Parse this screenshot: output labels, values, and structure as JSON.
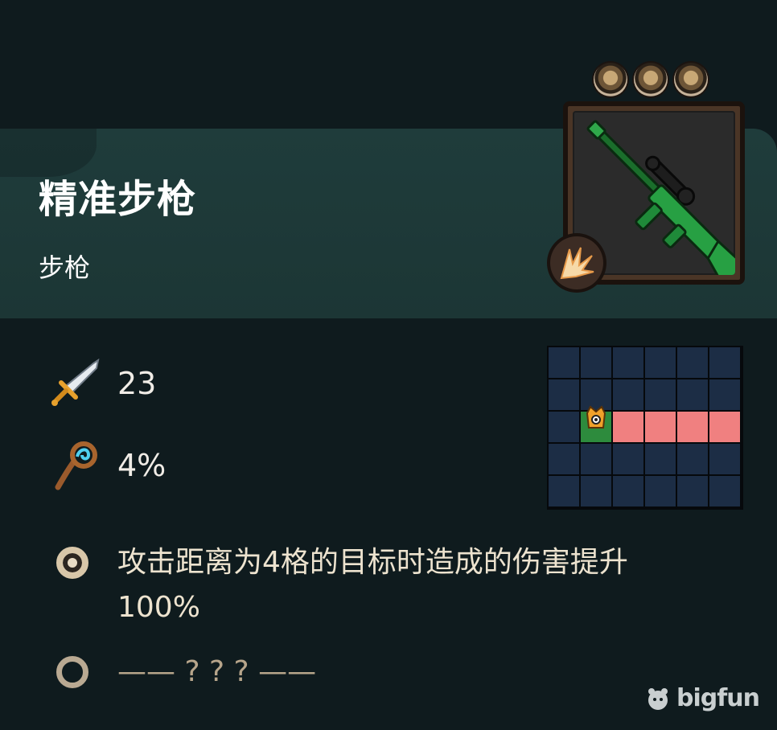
{
  "item": {
    "name": "精准步枪",
    "type": "步枪",
    "level_orbs": 3
  },
  "stats": {
    "attack": "23",
    "crit": "4%"
  },
  "range_grid": {
    "rows": 5,
    "cols": 6,
    "origin": [
      2,
      1
    ],
    "hits": [
      [
        2,
        2
      ],
      [
        2,
        3
      ],
      [
        2,
        4
      ],
      [
        2,
        5
      ]
    ]
  },
  "effects": [
    {
      "text": "攻击距离为4格的目标时造成的伤害提升100%",
      "unlocked": true
    },
    {
      "text": "—— ? ? ? ——",
      "unlocked": false
    }
  ],
  "watermark": {
    "text": "bigfun"
  },
  "colors": {
    "background": "#0f1b1e",
    "header": "#1f3c3b",
    "grid_cell": "#1c2d45",
    "grid_hit": "#f08080",
    "grid_origin": "#2d8b3d"
  },
  "icons": {
    "attack": "sword-icon",
    "crit": "staff-icon",
    "skill": "burst-icon",
    "weapon": "sniper-rifle-icon"
  }
}
